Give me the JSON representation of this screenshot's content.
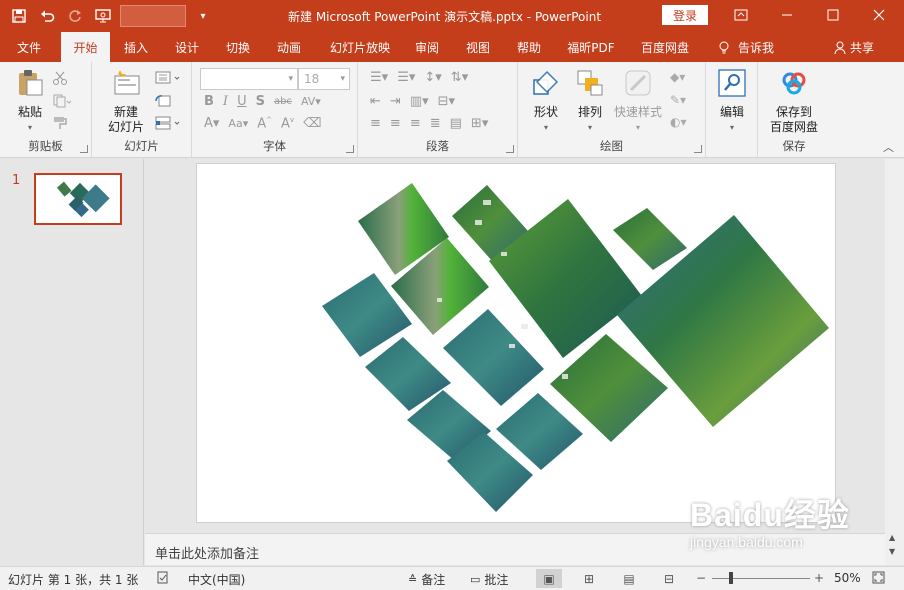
{
  "window": {
    "title": "新建 Microsoft PowerPoint 演示文稿.pptx  -  PowerPoint",
    "login_label": "登录",
    "controls": [
      "ribbon-display-icon",
      "minimize-icon",
      "maximize-icon",
      "close-icon"
    ]
  },
  "tabs": [
    {
      "label": "文件"
    },
    {
      "label": "开始"
    },
    {
      "label": "插入"
    },
    {
      "label": "设计"
    },
    {
      "label": "切换"
    },
    {
      "label": "动画"
    },
    {
      "label": "幻灯片放映"
    },
    {
      "label": "审阅"
    },
    {
      "label": "视图"
    },
    {
      "label": "帮助"
    },
    {
      "label": "福昕PDF"
    },
    {
      "label": "百度网盘"
    }
  ],
  "active_tab": "开始",
  "tell_me": "告诉我",
  "share": "共享",
  "ribbon": {
    "clipboard": {
      "paste": "粘贴",
      "group": "剪贴板"
    },
    "slides": {
      "new_slide_line1": "新建",
      "new_slide_line2": "幻灯片",
      "group": "幻灯片"
    },
    "font": {
      "size": "18",
      "group": "字体"
    },
    "paragraph": {
      "group": "段落"
    },
    "drawing": {
      "shape": "形状",
      "arrange": "排列",
      "quick_style": "快速样式",
      "group": "绘图"
    },
    "editing": {
      "edit": "编辑"
    },
    "save": {
      "line1": "保存到",
      "line2": "百度网盘",
      "group": "保存"
    }
  },
  "thumbnail": {
    "number": "1"
  },
  "notes_placeholder": "单击此处添加备注",
  "status": {
    "slide_info": "幻灯片 第 1 张，共 1 张",
    "language": "中文(中国)",
    "notes": "备注",
    "comments": "批注",
    "zoom": "50%"
  },
  "watermark": {
    "brand": "Baidu经验",
    "url": "jingyan.baidu.com"
  },
  "colors": {
    "accent": "#c43e1c",
    "ribbon_bg": "#f3f3f3"
  }
}
